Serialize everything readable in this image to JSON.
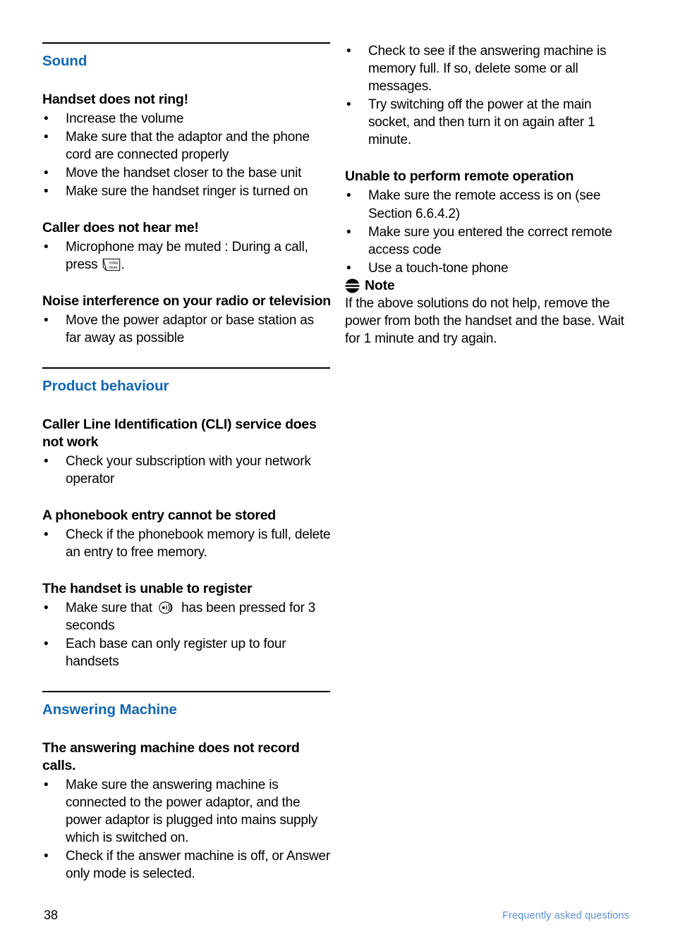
{
  "colors": {
    "section_heading_blue": "#1267b2",
    "footer_link_blue": "#5b8fd4",
    "body_text": "#000000"
  },
  "left_column": {
    "sections": [
      {
        "id": "sound",
        "title": "Sound",
        "blocks": [
          {
            "heading": "Handset does not ring!",
            "bullets": [
              "Increase the volume",
              "Make sure that the adaptor and the phone cord are connected properly",
              "Move the handset closer to the base unit",
              "Make sure the handset ringer is turned on"
            ]
          },
          {
            "heading": "Caller does not hear me!",
            "bullets_with_icon": {
              "before": "Microphone may be muted : During a call, press",
              "icon": "redial-mute-key-icon",
              "icon_label_top": "redial",
              "icon_label_bottom": "mute",
              "after": "."
            }
          },
          {
            "heading": "Noise interference on your radio or television",
            "bullets": [
              "Move the power adaptor or base station as far away as possible"
            ]
          }
        ]
      },
      {
        "id": "product-behaviour",
        "title": "Product behaviour",
        "blocks": [
          {
            "heading": "Caller Line Identification (CLI) service does not work",
            "bullets": [
              "Check your subscription with your network operator"
            ]
          },
          {
            "heading": "A phonebook entry cannot be stored",
            "bullets": [
              "Check if the phonebook memory is full, delete an entry to free memory."
            ]
          },
          {
            "heading": "The handset is unable to register",
            "bullets_with_icon": {
              "before": "Make sure that",
              "icon": "paging-key-icon",
              "after": "has been pressed for 3 seconds"
            },
            "bullets": [
              "Each base can only register up to four handsets"
            ]
          }
        ]
      },
      {
        "id": "answering-machine",
        "title": "Answering Machine",
        "blocks": [
          {
            "heading": "The answering machine does not record calls.",
            "bullets": [
              "Make sure the answering machine is connected to the power adaptor, and the power adaptor is plugged into mains supply which is switched on.",
              "Check if the answer machine is off, or Answer only mode is selected."
            ]
          }
        ]
      }
    ]
  },
  "right_column": {
    "continued_bullets": [
      "Check to see if the answering machine is memory full. If so, delete some or all messages.",
      "Try switching off the power at the main socket, and then turn it on again after 1 minute."
    ],
    "remote_operation": {
      "heading": "Unable to perform remote operation",
      "bullets": [
        "Make sure the remote access is on (see Section 6.6.4.2)",
        "Make sure you entered the correct remote access code",
        "Use a touch-tone phone"
      ]
    },
    "note": {
      "icon": "note-icon",
      "label": "Note",
      "body": "If the above solutions do not help, remove the power from both the handset and the base. Wait for 1 minute and try again."
    }
  },
  "footer": {
    "page_number": "38",
    "chapter_label": "Frequently asked questions"
  }
}
